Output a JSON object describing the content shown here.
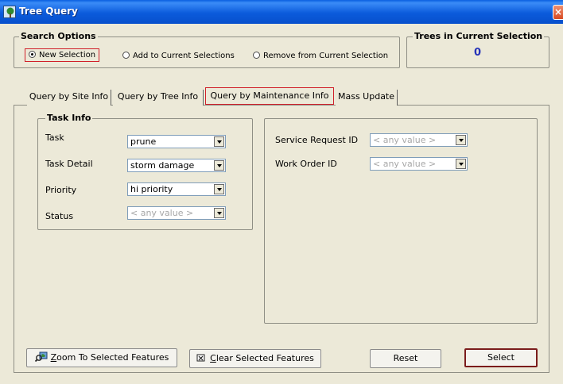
{
  "window": {
    "title": "Tree Query",
    "close_glyph": "×"
  },
  "search_options": {
    "title": "Search Options",
    "radios": [
      {
        "label": "New Selection",
        "selected": true
      },
      {
        "label": "Add to Current Selections",
        "selected": false
      },
      {
        "label": "Remove from Current Selection",
        "selected": false
      }
    ]
  },
  "trees_in_selection": {
    "title": "Trees in Current Selection",
    "count": "0"
  },
  "tabs": [
    {
      "label": "Query by Site Info",
      "active": false
    },
    {
      "label": "Query by Tree Info",
      "active": false
    },
    {
      "label": "Query by Maintenance Info",
      "active": true
    },
    {
      "label": "Mass Update",
      "active": false
    }
  ],
  "task_info": {
    "title": "Task Info",
    "fields": [
      {
        "label": "Task",
        "value": "prune",
        "disabled": false
      },
      {
        "label": "Task Detail",
        "value": "storm damage",
        "disabled": false
      },
      {
        "label": "Priority",
        "value": "hi priority",
        "disabled": false
      },
      {
        "label": "Status",
        "value": "< any value >",
        "disabled": true
      }
    ]
  },
  "ids": {
    "fields": [
      {
        "label": "Service Request ID",
        "value": "< any value >",
        "disabled": true
      },
      {
        "label": "Work Order ID",
        "value": "< any value >",
        "disabled": true
      }
    ]
  },
  "buttons": {
    "zoom": {
      "mnemonic": "Z",
      "rest": "oom To Selected Features"
    },
    "clear": {
      "mnemonic": "C",
      "rest": "lear Selected Features"
    },
    "reset": "Reset",
    "select": "Select"
  },
  "icons": {
    "title": "tree-icon",
    "zoom": "zoom-map-icon",
    "clear": "clear-selection-icon"
  },
  "colors": {
    "titlebar": "#0b5bdc",
    "count": "#2633b8",
    "highlight": "#d0202a"
  }
}
